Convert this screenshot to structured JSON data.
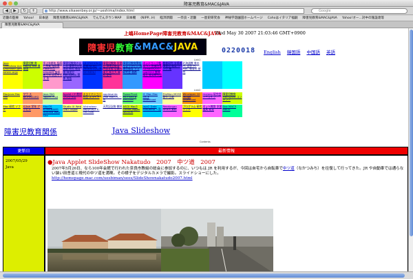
{
  "window": {
    "title": "障害児教育&MAC&JAVA"
  },
  "toolbar": {
    "url": "http://www.sikasenbey.or.jp/~ueshima/index.html",
    "search_placeholder": "Google"
  },
  "bookmarks": [
    "近畿の医療",
    "Yahoo!",
    "日本語",
    "障害児教育&MAC&JAVA",
    "でんでんタウンMAP",
    "日本機",
    "(NIPP...H)",
    "経済新聞",
    "一奈良・近畿",
    "一歴史研究会",
    "神秘学遊園田ホームページ",
    "Cohoはイタリア福嗣",
    "障害児教育&MAC&JAVA",
    "Yahoo!オー...対中の施設達等"
  ],
  "tab": {
    "label": "障害児教育&MAC&JAVA"
  },
  "header": {
    "site_title": "上嶋HomePage障害児教育&MAC&JAVA",
    "timestamp": "Wed May 30 2007 21:03:46 GMT+0900",
    "logo_parts": [
      "障害児",
      "教育",
      "&MAC&",
      "JAVA"
    ],
    "counter": "0220018",
    "lang_links": [
      "English",
      "韓国語",
      "中国語",
      "英語"
    ]
  },
  "link_grid_labels": [
    "Link1",
    "Link2"
  ],
  "link_grid_rows": [
    {
      "colors": [
        "#ffff00",
        "#ccff00",
        "#ff99cc",
        "#9966ff",
        "#0033ff",
        "#ff3399",
        "#3399ff",
        "#ff00ff",
        "#6633ff",
        "#ffffff",
        "#00ccff",
        "#00ffff",
        "#ffffff",
        "#ffffff",
        "#ffffff",
        "#ffffff",
        "#ffffff",
        "#ffffff",
        "#ffffff",
        "#ffffff"
      ],
      "items": [
        "Java Slideshow Ace s/nonishin gen amerc.or.jp",
        "障害児教 育Mac&J ava 携帯版",
        "学ぶ年齢年 指導と授業 指導案 Flash作品 simpteH 指導者主材 設置を考え る",
        "障害児教育のまとめ 障害児の就学前 研究 教育論 障害児 MAC&JAVA 関係 用語",
        "LD STATION 日記帳 NEWS 2000年1月以降 SKYMENU",
        "障害児教育 学習会 障害児教育 外部支援 会議所 東大 県立大 資料 配布",
        "障害児教育関係 ちょうきせい 障害児教育 マス 研究会 進路",
        "ネットワーク教育 ICT 授業改革 Sumatra2007 Lop2012 教育 県立 教育研究会",
        "教育研究 支援者 障害児 教育 リンク 集",
        "北海道教 育のPC 自作 PC MAC 教育の 研究",
        "",
        "",
        "",
        "",
        "",
        "",
        "",
        "",
        "",
        ""
      ]
    },
    {
      "colors": [
        "#ffff00",
        "#ff9966",
        "#ccff99",
        "#ff3399",
        "#ffcc00",
        "#ffffff",
        "#66ff66",
        "#66ccff",
        "#ffff99",
        "#ff9900",
        "#ff66ff",
        "#ccff00",
        "#ffffff",
        "#ffffff",
        "#ffffff",
        "#ffffff",
        "#ffffff",
        "#ffffff",
        "#ffffff",
        "#ffffff"
      ],
      "items": [
        "MacJava Mac Fan",
        "マウ ス BIOHAZARD",
        "Java FAQ Jiggles iPod",
        "Applet CP 教材 プログラム",
        "スライドショー 作品 スライド",
        "applesanta iPod MacOS 一覧",
        "PowerPlant MOTWEEB SYSTEM",
        "IC Mac Mac OS X Download",
        "FileMan MOSS 動作 比較",
        "Winzipper 10 Image Download",
        "mojang 研究会 アーカイブ",
        "障害児教育 Mac&JAVA コンテンツ",
        "",
        "",
        "",
        "",
        "",
        "",
        "",
        ""
      ]
    },
    {
      "colors": [
        "#ffff00",
        "#ff9966",
        "#00ccff",
        "#ffff66",
        "#ffffff",
        "#ffffff",
        "#ccff00",
        "#00ccff",
        "#ff66ff",
        "#ffff00",
        "#ff66ff",
        "#00ff99",
        "#ffffff",
        "#ffffff",
        "#ffffff",
        "#ffffff",
        "#ffffff",
        "#ffffff",
        "#ffffff",
        "#ffffff"
      ],
      "items": [
        "Mac 研究 ソフト",
        "ICAsh 学年 アクセス",
        "MacOS KOMANAMS Yamaha Web Site",
        "Studio IX Web GNU Skype",
        "Allstrotear papyrus/2 E-cell.com",
        "天然記念物 教材",
        "ASCII Mac3 Cocoa Jagger IDOSOS",
        "Jazz2 Data FileDemo 一覧",
        "Readymen ARIEA 資料",
        "プログラム 研究 ソフト",
        "ネット教育 学習 道具 教育",
        "Doc MAC3 MoOS",
        "",
        "",
        "",
        "",
        "",
        "",
        "",
        ""
      ]
    }
  ],
  "headings": {
    "left": "障害児教育関係",
    "right": "Java Slideshow"
  },
  "table": {
    "caption": "Contents",
    "col_date": "更新日",
    "col_news": "最新情報",
    "date": "2007/05/29",
    "left_note": "Java",
    "news_title": "●Java Applet SlideShow Nakatudo　2007　中ツ道　2007",
    "news_body": "2007年5月26日、なら100年会館で行われた奈良市教組の総会に参加するのに、いつもは JR を利用するが、今回は自宅から自転車で",
    "news_link_inline": "中ツ道",
    "news_body_2": "（なかつみち）を往復して行ってきた。JR や自動車では通らない狭い田舎道と現代の中ツ道を満喫。その様子をデジタルカメラで撮影。スライドショーにした。",
    "news_url": "http://homepage.mac.com/uesbiman/sees/SlideShownakatudo2007.html"
  },
  "colors": {
    "header_blue": "#0000ee",
    "header_red": "#ee0000",
    "date_cell": "#ddee00",
    "site_title": "#cc0000",
    "link": "#0000cc"
  }
}
